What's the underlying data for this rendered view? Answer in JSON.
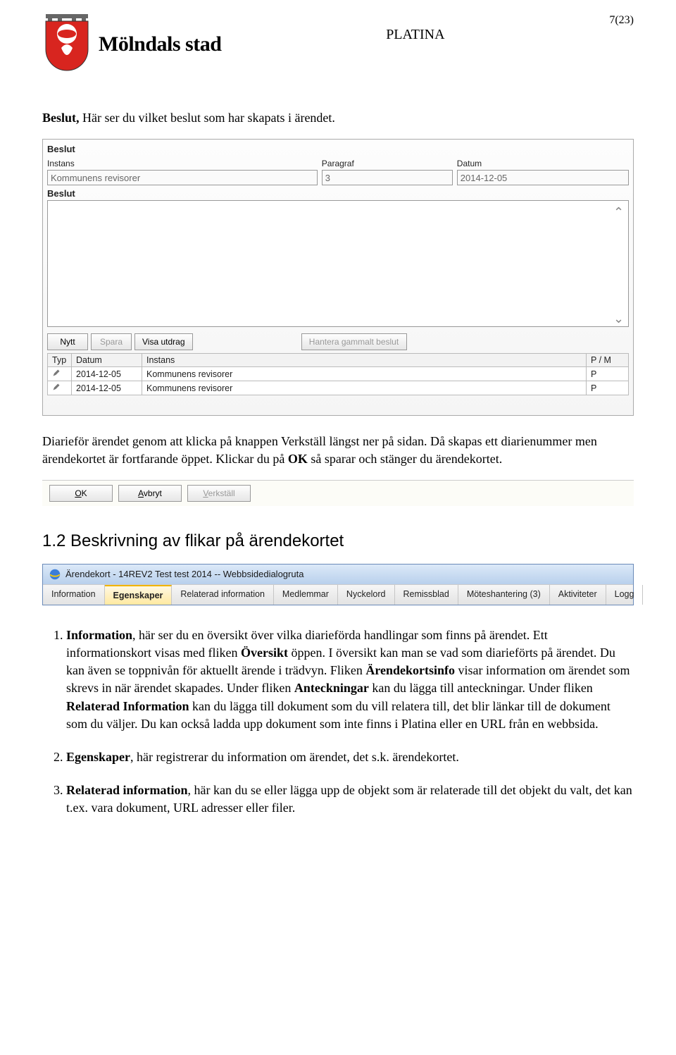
{
  "header": {
    "logo_text": "Mölndals stad",
    "center": "PLATINA",
    "page": "7(23)"
  },
  "p_beslut_intro_bold": "Beslut,",
  "p_beslut_intro_rest": " Här ser du vilket beslut som har skapats i ärendet.",
  "beslut_ui": {
    "title": "Beslut",
    "lbl_instans": "Instans",
    "val_instans": "Kommunens revisorer",
    "lbl_paragraf": "Paragraf",
    "val_paragraf": "3",
    "lbl_datum": "Datum",
    "val_datum": "2014-12-05",
    "lbl_beslut": "Beslut",
    "btn_nytt": "Nytt",
    "btn_spara": "Spara",
    "btn_visa": "Visa utdrag",
    "btn_hantera": "Hantera gammalt beslut",
    "cols": {
      "typ": "Typ",
      "datum": "Datum",
      "instans": "Instans",
      "pm": "P / M"
    },
    "rows": [
      {
        "datum": "2014-12-05",
        "instans": "Kommunens revisorer",
        "pm": "P"
      },
      {
        "datum": "2014-12-05",
        "instans": "Kommunens revisorer",
        "pm": "P"
      }
    ]
  },
  "p_diariefor_1": "Diarieför ärendet genom att klicka på knappen Verkställ längst ner på sidan. Då skapas ett diarienummer men ärendekortet är fortfarande öppet. Klickar du på ",
  "p_diariefor_bold": "OK",
  "p_diariefor_2": " så sparar och stänger du ärendekortet.",
  "okbar": {
    "ok": "OK",
    "avbryt": "Avbryt",
    "verkstall": "Verkställ"
  },
  "section_12": "1.2   Beskrivning av flikar på ärendekortet",
  "tabwin": {
    "title": "Ärendekort - 14REV2 Test test 2014 -- Webbsidedialogruta",
    "tabs": [
      "Information",
      "Egenskaper",
      "Relaterad information",
      "Medlemmar",
      "Nyckelord",
      "Remissblad",
      "Möteshantering (3)",
      "Aktiviteter",
      "Logg"
    ],
    "active_index": 1
  },
  "li1_bold": "Information",
  "li1_text_1": ", här ser du en översikt över vilka diarieförda handlingar som finns på ärendet. Ett informationskort visas med fliken ",
  "li1_bold2": "Översikt",
  "li1_text_2": " öppen. I översikt kan man se vad som diarieförts på ärendet. Du kan även se toppnivån för aktuellt ärende i trädvyn. Fliken ",
  "li1_bold3": "Ärendekortsinfo",
  "li1_text_3": " visar information om ärendet som skrevs in när ärendet skapades. Under fliken ",
  "li1_bold4": "Anteckningar",
  "li1_text_4": " kan du lägga till anteckningar. Under fliken ",
  "li1_bold5": "Relaterad Information",
  "li1_text_5": " kan du lägga till dokument som du vill relatera till, det blir länkar till de dokument som du väljer. Du kan också ladda upp dokument som inte finns i Platina eller en URL från en webbsida.",
  "li2_bold": "Egenskaper",
  "li2_text": ", här registrerar du information om ärendet, det s.k. ärendekortet.",
  "li3_bold": "Relaterad information",
  "li3_text": ", här kan du se eller lägga upp de objekt som är relaterade till det objekt du valt, det kan t.ex. vara dokument, URL adresser eller filer."
}
